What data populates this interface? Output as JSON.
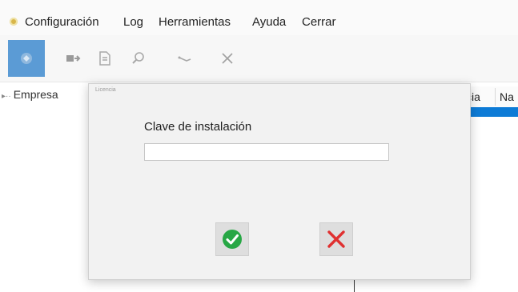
{
  "menu": {
    "items": [
      "Configuración",
      "Log",
      "Herramientas",
      "Ayuda",
      "Cerrar"
    ]
  },
  "toolbar": {
    "icons": [
      "app-icon",
      "connect-icon",
      "document-icon",
      "search-icon",
      "pen-icon",
      "close-icon"
    ]
  },
  "tree": {
    "item": "Empresa"
  },
  "table": {
    "columns": [
      "cia",
      "Na"
    ]
  },
  "dialog": {
    "title": "Licencia",
    "label": "Clave de instalación",
    "input_value": "",
    "input_placeholder": "",
    "ok_icon": "check-icon",
    "cancel_icon": "x-icon"
  },
  "colors": {
    "toolbar_active": "#5b9bd5",
    "selection": "#0d7bd6",
    "ok_green": "#27a745",
    "cancel_red": "#e03030"
  }
}
